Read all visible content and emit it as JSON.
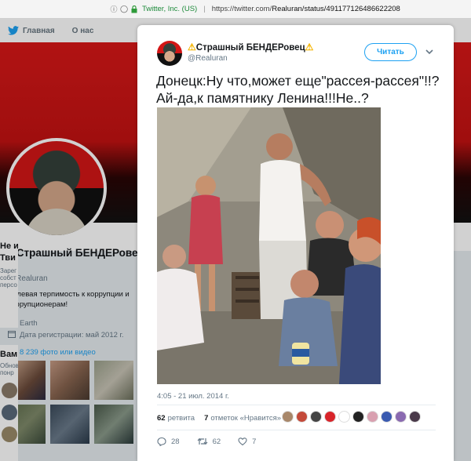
{
  "browser": {
    "owner": "Twitter, Inc. (US)",
    "url_prefix": "https://twitter.com/",
    "url_path": "Realuran/status/491177126486622208"
  },
  "nav": {
    "home_label": "Главная",
    "about_label": "О нас"
  },
  "profile": {
    "name": "Страшный БЕНДЕРовец",
    "handle": "@Realuran",
    "bio": "Нулевая терпимость к коррупции и коррупционерам!",
    "location": "Earth",
    "joined": "Дата регистрации: май 2012 г.",
    "photos_label": "8 239 фото или видео"
  },
  "right_sidebar": {
    "card1": "Не и",
    "card1_b": "Тви",
    "card1_c": "Зарег",
    "card1_d": "собст",
    "card1_e": "персо",
    "card2": "Вам",
    "card2_b": "Обнов",
    "card2_c": "понр"
  },
  "tweet": {
    "author_name": "Страшный БЕНДЕРовец",
    "author_handle": "@Realuran",
    "follow_label": "Читать",
    "text": "Донецк:Ну что,может еще\"рассея-рассея\"!!?Ай-да,к памятнику Ленина!!!Не..?",
    "timestamp": "4:05 - 21 июл. 2014 г.",
    "retweets_count": "62",
    "retweets_label": "ретвита",
    "likes_count": "7",
    "likes_label": "отметок «Нравится»",
    "reply_count": "28",
    "retweet_action_count": "62",
    "like_action_count": "7"
  },
  "colors": {
    "accent": "#1da1f2",
    "banner_red": "#d81818",
    "warning": "#f5b400"
  }
}
